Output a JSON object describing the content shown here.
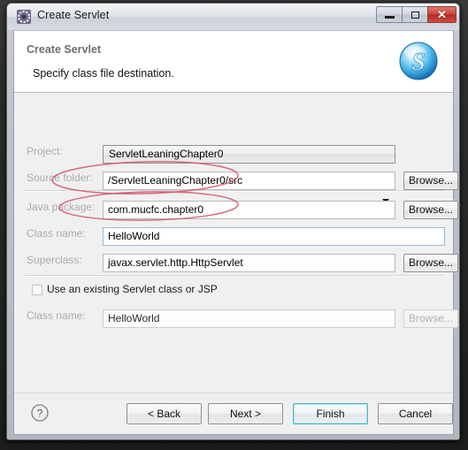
{
  "window": {
    "title": "Create Servlet",
    "icon": "eclipse-gear-icon",
    "controls": {
      "minimize": "–",
      "maximize": "□",
      "close": "✕"
    }
  },
  "banner": {
    "title": "Create Servlet",
    "description": "Specify class file destination.",
    "logo": "servlet-blue-s-icon"
  },
  "form": {
    "project": {
      "label": "Project:",
      "value": "ServletLeaningChapter0",
      "control": "combobox",
      "arrow_icon": "chevron-down-icon"
    },
    "source_folder": {
      "label": "Source folder:",
      "value": "/ServletLeaningChapter0/src",
      "browse_label": "Browse..."
    },
    "java_package": {
      "label": "Java package:",
      "value": "com.mucfc.chapter0",
      "browse_label": "Browse..."
    },
    "class_name": {
      "label": "Class name:",
      "value": "HelloWorld"
    },
    "superclass": {
      "label": "Superclass:",
      "value": "javax.servlet.http.HttpServlet",
      "browse_label": "Browse..."
    },
    "use_existing": {
      "label": "Use an existing Servlet class or JSP",
      "checked": false
    },
    "existing_class_name": {
      "label": "Class name:",
      "value": "HelloWorld",
      "browse_label": "Browse..."
    }
  },
  "buttons": {
    "help": "?",
    "back": "< Back",
    "next": "Next >",
    "finish": "Finish",
    "cancel": "Cancel"
  },
  "colors": {
    "accent": "#4fb4c8",
    "annotation": "#d1596b",
    "close_button": "#c9433a",
    "label_disabled": "#acacac",
    "banner_bg": "#ffffff"
  },
  "annotations": [
    {
      "name": "java-package-ellipse",
      "shape": "ellipse",
      "color": "#d1596b"
    },
    {
      "name": "class-name-ellipse",
      "shape": "ellipse",
      "color": "#d1596b"
    }
  ]
}
